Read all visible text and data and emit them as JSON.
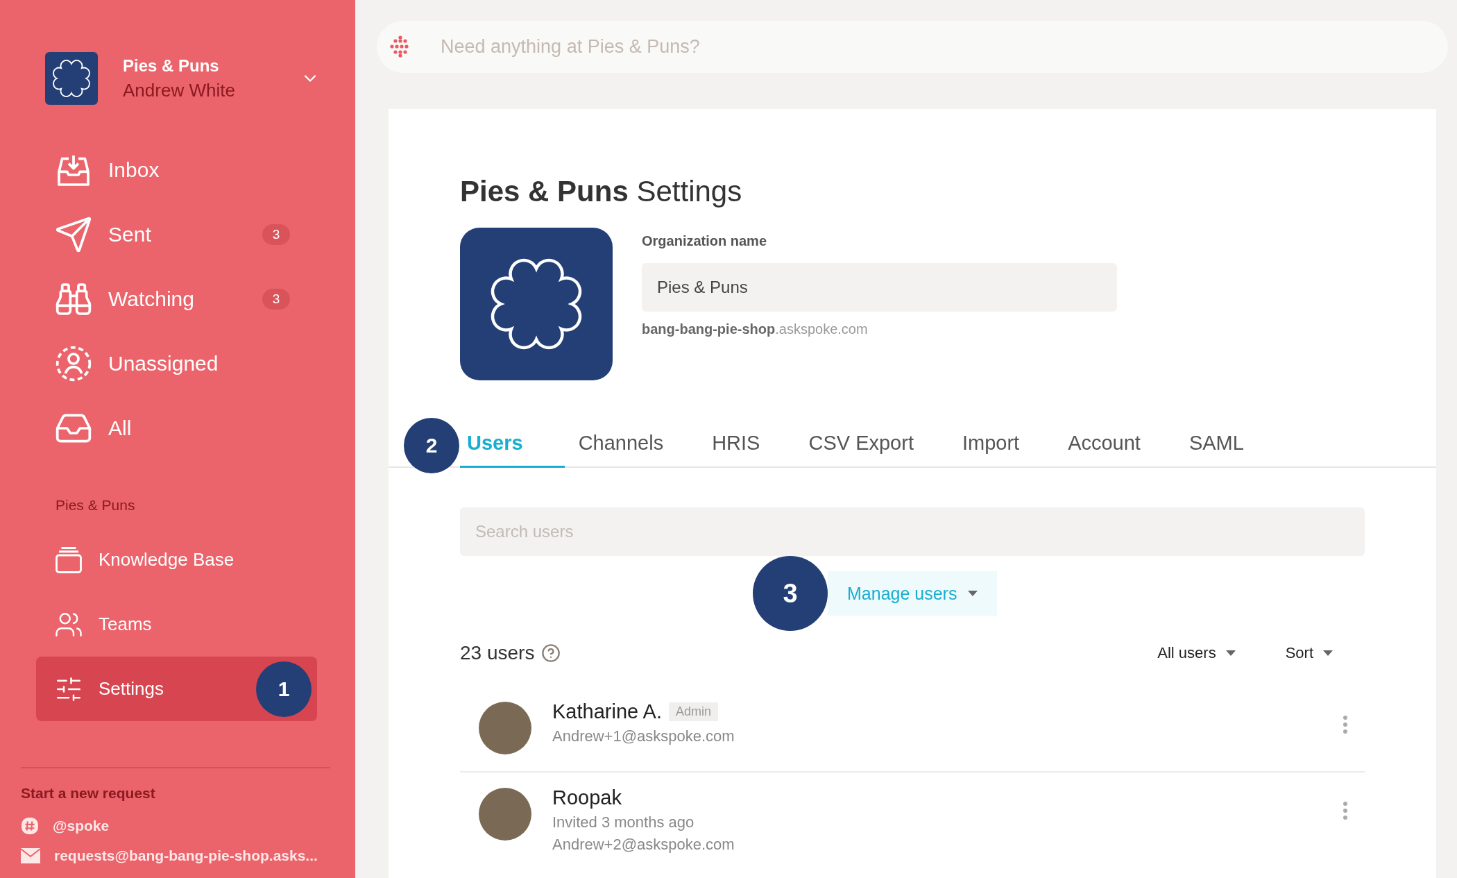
{
  "sidebar": {
    "org_name": "Pies & Puns",
    "user_name": "Andrew White",
    "nav_items": [
      {
        "kind": "inbox",
        "label": "Inbox",
        "selected": false
      },
      {
        "kind": "sent",
        "label": "Sent",
        "badge": "3",
        "selected": false
      },
      {
        "kind": "watching",
        "label": "Watching",
        "badge": "3",
        "selected": false
      },
      {
        "kind": "unassigned",
        "label": "Unassigned",
        "selected": false
      },
      {
        "kind": "all",
        "label": "All",
        "selected": false
      }
    ],
    "section_title": "Pies & Puns",
    "section_items": [
      {
        "kind": "knowledge",
        "label": "Knowledge Base",
        "selected": false
      },
      {
        "kind": "teams",
        "label": "Teams",
        "selected": false
      },
      {
        "kind": "settings",
        "label": "Settings",
        "selected": true,
        "marker": "1"
      }
    ],
    "new_request": {
      "title": "Start a new request",
      "links": [
        {
          "kind": "slack",
          "label": "@spoke"
        },
        {
          "kind": "email",
          "label": "requests@bang-bang-pie-shop.asks..."
        }
      ]
    }
  },
  "search": {
    "placeholder": "Need anything at Pies & Puns?"
  },
  "settings": {
    "title": "**Pies & Puns** Settings",
    "org_label": "Organization name",
    "org_value": "Pies & Puns",
    "domain": "**bang-bang-pie-shop**.askspoke.com",
    "tabs": [
      {
        "label": "Users",
        "selected": true,
        "marker": "2"
      },
      {
        "label": "Channels",
        "selected": false
      },
      {
        "label": "HRIS",
        "selected": false
      },
      {
        "label": "CSV Export",
        "selected": false
      },
      {
        "label": "Import",
        "selected": false
      },
      {
        "label": "Account",
        "selected": false
      },
      {
        "label": "SAML",
        "selected": false
      }
    ],
    "user_search": {
      "placeholder": "Search users"
    },
    "manage_button": {
      "label": "Manage users",
      "marker": "3"
    },
    "user_count": "23 users",
    "filters": [
      "All users",
      "Sort"
    ],
    "users": [
      {
        "name": "Katharine A.",
        "role": "Admin",
        "details": [
          "Andrew+1@askspoke.com"
        ]
      },
      {
        "name": "Roopak",
        "details": [
          "Invited 3 months ago",
          "Andrew+2@askspoke.com"
        ]
      }
    ]
  }
}
